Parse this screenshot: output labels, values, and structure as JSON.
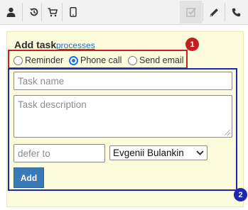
{
  "toolbar": {
    "buttons": [
      {
        "icon": "user-icon",
        "glyph": "👤"
      },
      {
        "icon": "history-icon",
        "glyph": "⟲"
      },
      {
        "icon": "cart-icon",
        "glyph": "🛒"
      },
      {
        "icon": "tablet-icon",
        "glyph": "▯"
      },
      {
        "icon": "checkbox-icon",
        "glyph": "☑"
      },
      {
        "icon": "pencil-icon",
        "glyph": "✎"
      },
      {
        "icon": "phone-icon",
        "glyph": "☎"
      }
    ]
  },
  "task": {
    "title": "Add task",
    "link": "processes"
  },
  "radios": {
    "reminder": "Reminder",
    "phone_call": "Phone call",
    "send_email": "Send email",
    "selected": "Phone call"
  },
  "form": {
    "task_name_placeholder": "Task name",
    "task_description_placeholder": "Task description",
    "defer_placeholder": "defer to",
    "assignee_selected": "Evgenii Bulankin",
    "add_label": "Add"
  },
  "badges": {
    "one": "1",
    "two": "2"
  },
  "colors": {
    "panel_bg": "#fcfbdc",
    "red_highlight": "#c32020",
    "blue_highlight": "#1e27b0",
    "add_button": "#3a7ab8",
    "link": "#2a6ebb"
  }
}
